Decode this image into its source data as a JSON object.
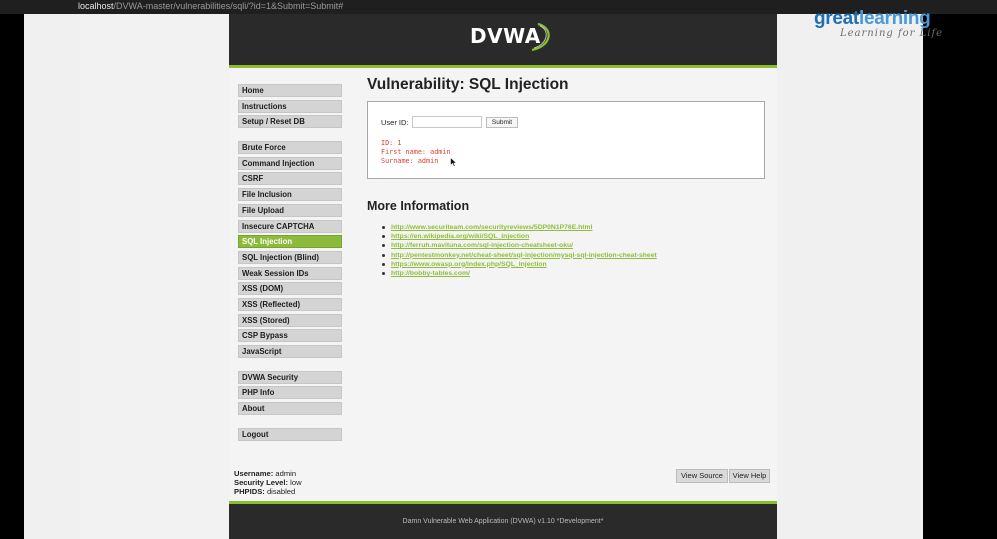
{
  "browser": {
    "url_host": "localhost",
    "url_path": "/DVWA-master/vulnerabilities/sqli/?id=1&Submit=Submit#"
  },
  "header": {
    "logo_text": "DVWA"
  },
  "menu": {
    "group1": [
      "Home",
      "Instructions",
      "Setup / Reset DB"
    ],
    "group2": [
      "Brute Force",
      "Command Injection",
      "CSRF",
      "File Inclusion",
      "File Upload",
      "Insecure CAPTCHA",
      "SQL Injection",
      "SQL Injection (Blind)",
      "Weak Session IDs",
      "XSS (DOM)",
      "XSS (Reflected)",
      "XSS (Stored)",
      "CSP Bypass",
      "JavaScript"
    ],
    "group3": [
      "DVWA Security",
      "PHP Info",
      "About"
    ],
    "group4": [
      "Logout"
    ],
    "selected": "SQL Injection"
  },
  "main": {
    "title": "Vulnerability: SQL Injection",
    "form": {
      "userid_label": "User ID:",
      "userid_value": "",
      "submit_label": "Submit"
    },
    "result": {
      "line1": "ID: 1",
      "line2": "First name: admin",
      "line3": "Surname: admin"
    },
    "more_info_heading": "More Information",
    "links": [
      "http://www.securiteam.com/securityreviews/5DP0N1P76E.html",
      "https://en.wikipedia.org/wiki/SQL_injection",
      "http://ferruh.mavituna.com/sql-injection-cheatsheet-oku/",
      "http://pentestmonkey.net/cheat-sheet/sql-injection/mysql-sql-injection-cheat-sheet",
      "https://www.owasp.org/index.php/SQL_Injection",
      "http://bobby-tables.com/"
    ]
  },
  "status": {
    "username_label": "Username:",
    "username": "admin",
    "security_label": "Security Level:",
    "security": "low",
    "phpids_label": "PHPIDS:",
    "phpids": "disabled"
  },
  "buttons": {
    "view_source": "View Source",
    "view_help": "View Help"
  },
  "footer": {
    "text": "Damn Vulnerable Web Application (DVWA) v1.10 *Development*"
  },
  "watermark": {
    "brand_part1": "great",
    "brand_part2": "learning",
    "tagline": "Learning for Life"
  },
  "colors": {
    "accent_green": "#8bbd2f",
    "link_green": "#8fbd3b",
    "result_red": "#d64432",
    "header_dark": "#2a2a2a"
  }
}
